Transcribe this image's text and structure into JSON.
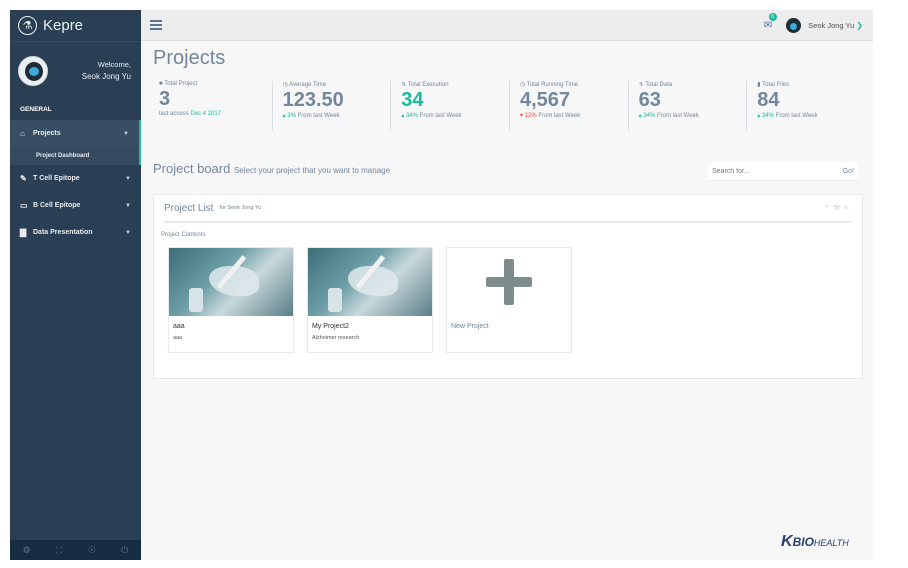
{
  "brand": {
    "name": "Kepre",
    "icon": "flask-icon"
  },
  "profile": {
    "welcome": "Welcome,",
    "name": "Seok Jong Yu"
  },
  "sidebar": {
    "section": "GENERAL",
    "items": [
      {
        "label": "Projects",
        "icon": "home-icon"
      },
      {
        "label": "T Cell Epitope",
        "icon": "edit-icon"
      },
      {
        "label": "B Cell Epitope",
        "icon": "desktop-icon"
      },
      {
        "label": "Data Presentation",
        "icon": "bar-chart-icon"
      }
    ],
    "subitem": "Project Dashboard",
    "footer_icons": [
      "settings-icon",
      "fullscreen-icon",
      "eye-slash-icon",
      "power-icon"
    ]
  },
  "topbar": {
    "mail_badge": "6",
    "user": "Seok Jong Yu"
  },
  "page": {
    "title": "Projects"
  },
  "stats": [
    {
      "label": "Total Project",
      "value": "3",
      "foot_pre": "last access ",
      "foot_hl": "Dec 4 2017",
      "foot_post": "",
      "value_color": "default",
      "foot_color": "green"
    },
    {
      "label": "Average Time",
      "value": "123.50",
      "foot_pre": "",
      "foot_hl": "3%",
      "foot_post": " From last Week",
      "value_color": "default",
      "foot_color": "green"
    },
    {
      "label": "Total Execution",
      "value": "34",
      "foot_pre": "",
      "foot_hl": "34%",
      "foot_post": " From last Week",
      "value_color": "green",
      "foot_color": "green"
    },
    {
      "label": "Total Running Time",
      "value": "4,567",
      "foot_pre": "",
      "foot_hl": "12%",
      "foot_post": " From last Week",
      "value_color": "default",
      "foot_color": "red"
    },
    {
      "label": "Total Data",
      "value": "63",
      "foot_pre": "",
      "foot_hl": "34%",
      "foot_post": " From last Week",
      "value_color": "default",
      "foot_color": "green"
    },
    {
      "label": "Total Files",
      "value": "84",
      "foot_pre": "",
      "foot_hl": "34%",
      "foot_post": " From last Week",
      "value_color": "default",
      "foot_color": "green"
    }
  ],
  "board": {
    "title": "Project board",
    "subtitle": "Select your project that you want to manage",
    "search_placeholder": "Search for...",
    "go": "Go!"
  },
  "panel": {
    "title": "Project List",
    "subtitle": "for Seok Jong Yu",
    "contents_label": "Project Contents",
    "cards": [
      {
        "title": "aaa",
        "desc": "aaa"
      },
      {
        "title": "My Project2",
        "desc": "Alzheimer research"
      }
    ],
    "new_label": "New Project"
  },
  "logo": {
    "k": "K",
    "bio": "BIO",
    "health": "HEALTH"
  },
  "colors": {
    "sidebar": "#2a3f54",
    "accent": "#1abb9c",
    "down": "#e74c3c"
  }
}
